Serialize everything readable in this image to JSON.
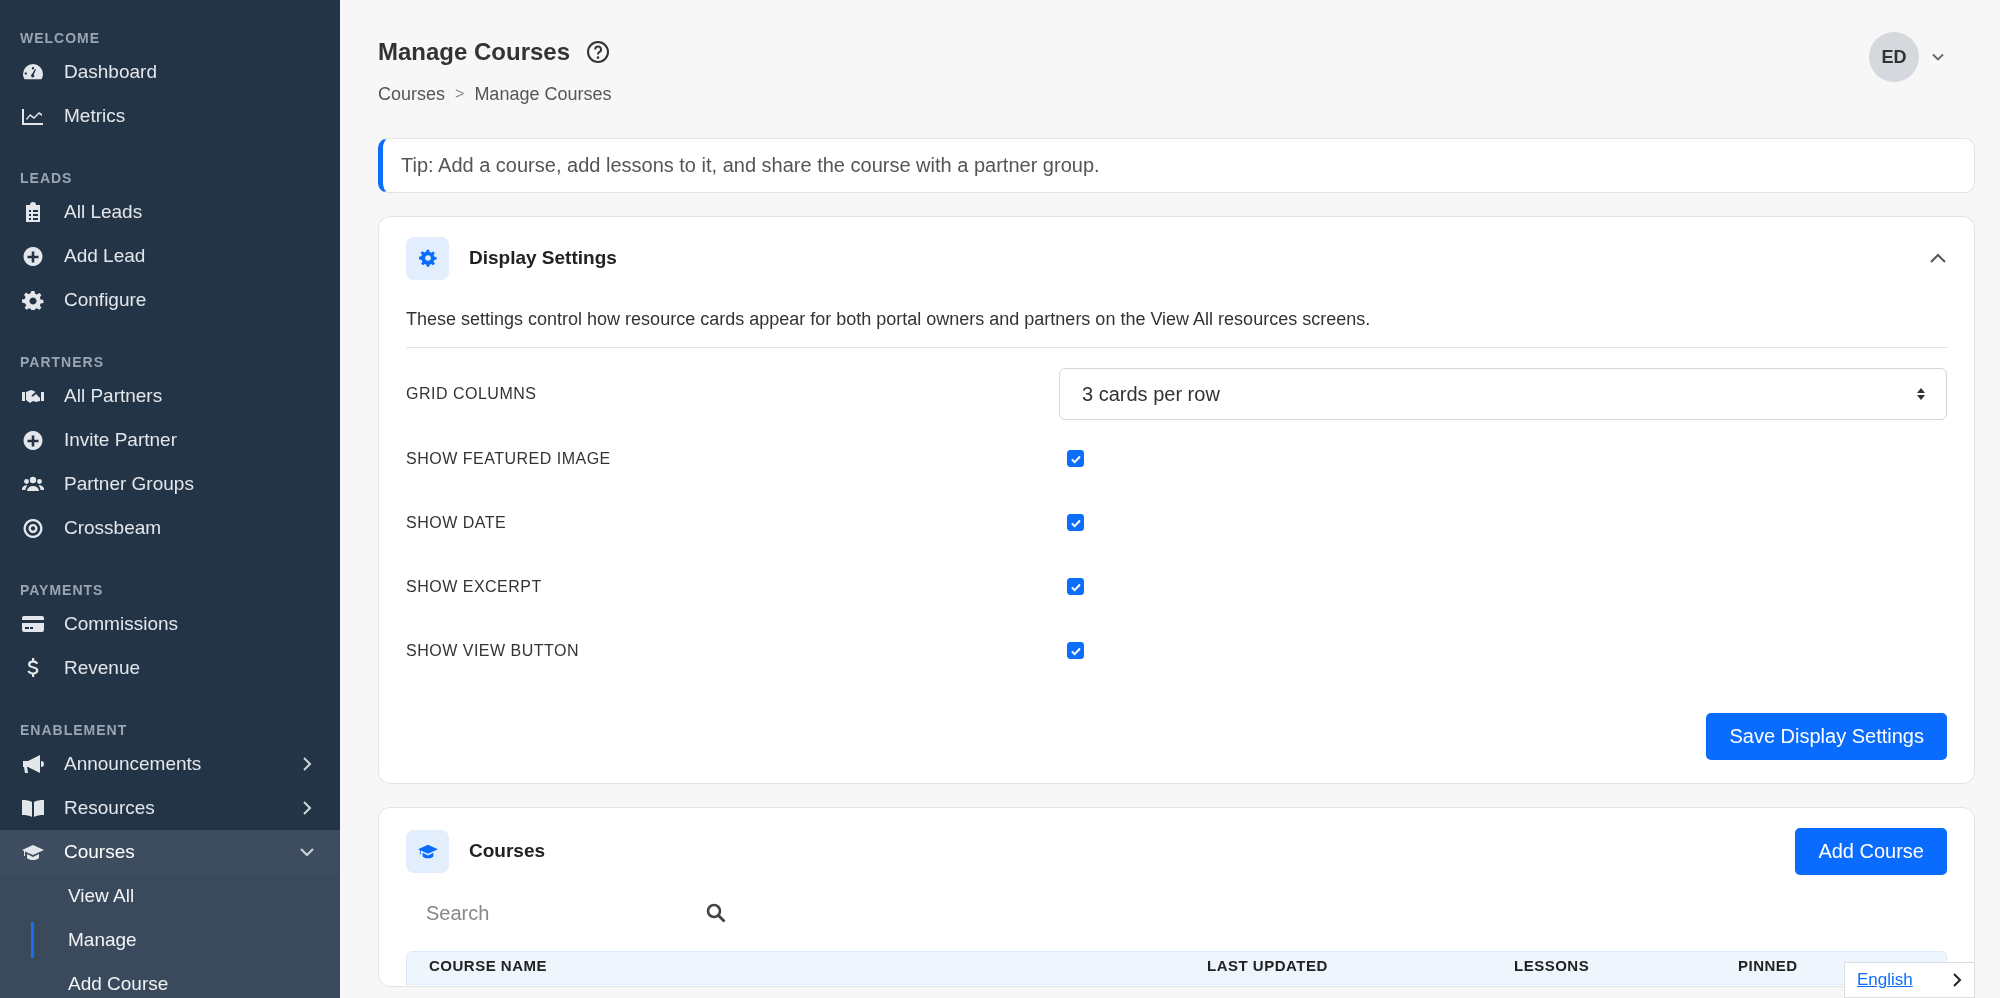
{
  "sidebar": {
    "sections": [
      {
        "heading": "WELCOME",
        "items": [
          {
            "label": "Dashboard",
            "selected": false
          },
          {
            "label": "Metrics",
            "selected": false
          }
        ]
      },
      {
        "heading": "LEADS",
        "items": [
          {
            "label": "All Leads",
            "selected": false
          },
          {
            "label": "Add Lead",
            "selected": false
          },
          {
            "label": "Configure",
            "selected": false
          }
        ]
      },
      {
        "heading": "PARTNERS",
        "items": [
          {
            "label": "All Partners",
            "selected": false
          },
          {
            "label": "Invite Partner",
            "selected": false
          },
          {
            "label": "Partner Groups",
            "selected": false
          },
          {
            "label": "Crossbeam",
            "selected": false
          }
        ]
      },
      {
        "heading": "PAYMENTS",
        "items": [
          {
            "label": "Commissions",
            "selected": false
          },
          {
            "label": "Revenue",
            "selected": false
          }
        ]
      },
      {
        "heading": "ENABLEMENT",
        "items": [
          {
            "label": "Announcements",
            "selected": false,
            "expanded": false
          },
          {
            "label": "Resources",
            "selected": false,
            "expanded": false
          },
          {
            "label": "Courses",
            "selected": true,
            "expanded": true,
            "children": [
              {
                "label": "View All",
                "selected": false
              },
              {
                "label": "Manage",
                "selected": true
              },
              {
                "label": "Add Course",
                "selected": false
              }
            ]
          }
        ]
      }
    ]
  },
  "header": {
    "title": "Manage Courses",
    "breadcrumb": [
      "Courses",
      "Manage Courses"
    ],
    "breadcrumb_separator": ">",
    "avatar": "ED"
  },
  "tip": "Tip: Add a course, add lessons to it, and share the course with a partner group.",
  "display_settings": {
    "title": "Display Settings",
    "expanded": true,
    "description": "These settings control how resource cards appear for both portal owners and partners on the View All resources screens.",
    "rows": [
      {
        "kind": "select",
        "label": "GRID COLUMNS",
        "value": "3 cards per row"
      },
      {
        "kind": "checkbox",
        "label": "SHOW FEATURED IMAGE",
        "checked": true
      },
      {
        "kind": "checkbox",
        "label": "SHOW DATE",
        "checked": true
      },
      {
        "kind": "checkbox",
        "label": "SHOW EXCERPT",
        "checked": true
      },
      {
        "kind": "checkbox",
        "label": "SHOW VIEW BUTTON",
        "checked": true
      }
    ],
    "save_button": "Save Display Settings"
  },
  "courses": {
    "title": "Courses",
    "add_button": "Add Course",
    "search": {
      "placeholder": "Search"
    },
    "table": {
      "columns": [
        "COURSE NAME",
        "LAST UPDATED",
        "LESSONS",
        "PINNED"
      ]
    }
  },
  "language": {
    "label": "English"
  }
}
